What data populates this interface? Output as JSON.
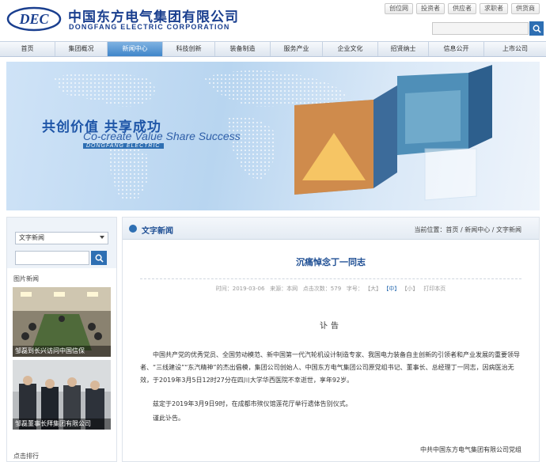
{
  "header": {
    "logo_text": "DEC",
    "company_cn": "中国东方电气集团有限公司",
    "company_en": "DONGFANG ELECTRIC CORPORATION",
    "top_links": [
      "创位网",
      "投资者",
      "供应者",
      "求职者",
      "供货商"
    ],
    "search_placeholder": ""
  },
  "nav": {
    "items": [
      "首页",
      "集团概况",
      "新闻中心",
      "科技创新",
      "装备制造",
      "服务产业",
      "企业文化",
      "招贤纳士",
      "信息公开",
      "上市公司"
    ],
    "active_index": 2
  },
  "banner": {
    "slogan_cn": "共创价值  共享成功",
    "slogan_en": "Co-create Value Share Success",
    "tag_en": "DONGFANG ELECTRIC"
  },
  "sidebar": {
    "select_value": "文字新闻",
    "search_value": "",
    "section_title": "图片新闻",
    "photos": [
      {
        "caption": "邹磊到长兴访问中国信保"
      },
      {
        "caption": "邹磊董事长拜集团有限公司"
      }
    ],
    "section_title2": "点击排行"
  },
  "main": {
    "section_title": "文字新闻",
    "breadcrumb": "当前位置：首页 / 新闻中心 / 文字新闻",
    "article_title": "沉痛悼念丁一同志",
    "meta_time": "时间：2019-03-06",
    "meta_source": "来源：本网",
    "meta_views": "点击次数：579",
    "meta_font": "字号：",
    "meta_size_large": "【大】",
    "meta_size_mid": "【中】",
    "meta_size_small": "【小】",
    "meta_print": "打印本页",
    "notice_title": "讣告",
    "paragraph1": "中国共产党的优秀党员、全国劳动模范、新中国第一代汽轮机设计制造专家、我国电力装备自主创新的引领者和产业发展的重要领导者、“三线建设”“东汽精神”的杰出倡模，集团公司创始人、中国东方电气集团公司原党组书记、董事长、总经理丁一同志，因病医治无效，于2019年3月5日12时27分在四川大学华西医院不幸逝世，享年92岁。",
    "paragraph2": "兹定于2019年3月9日9时，在成都市殡仪馆莲花厅举行遗体告别仪式。",
    "paragraph3": "谨此讣告。",
    "signature": "中共中国东方电气集团有限公司党组"
  },
  "colors": {
    "brand_blue": "#1a3f8f",
    "accent_blue": "#2e6fb3"
  }
}
